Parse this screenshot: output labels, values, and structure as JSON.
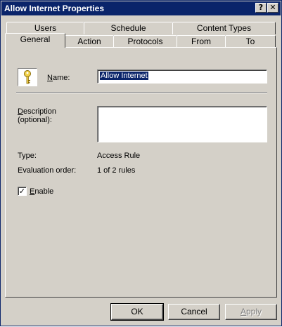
{
  "window": {
    "title": "Allow Internet Properties",
    "help_glyph": "?",
    "close_glyph": "✕"
  },
  "tabs": {
    "back_row": [
      "Users",
      "Schedule",
      "Content Types"
    ],
    "front_row": [
      "General",
      "Action",
      "Protocols",
      "From",
      "To"
    ],
    "selected": "General"
  },
  "general": {
    "icon": "key-icon",
    "name_label_underlined": "N",
    "name_label_rest": "ame:",
    "name_value": "Allow Internet",
    "description_label_underlined": "D",
    "description_label_rest": "escription",
    "description_label_line2": "(optional):",
    "description_value": "",
    "type_label": "Type:",
    "type_value": "Access Rule",
    "eval_label": "Evaluation order:",
    "eval_value": "1 of 2 rules",
    "enable_checked": true,
    "enable_check_glyph": "✓",
    "enable_label_underlined": "E",
    "enable_label_rest": "nable"
  },
  "buttons": {
    "ok": "OK",
    "cancel": "Cancel",
    "apply_underlined": "A",
    "apply_rest": "pply"
  },
  "colors": {
    "titlebar": "#0a246a",
    "face": "#d4d0c8",
    "selection": "#0a246a"
  }
}
